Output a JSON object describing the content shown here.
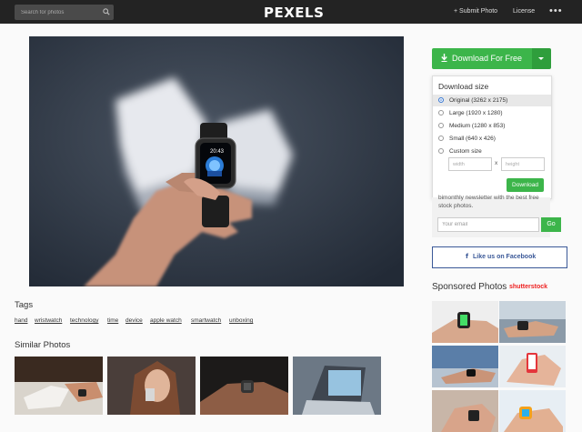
{
  "header": {
    "search_placeholder": "Search for photos",
    "logo": "PEXELS",
    "submit_label": "+ Submit Photo",
    "license_label": "License",
    "more_label": "•••"
  },
  "photo": {
    "watch_time": "20:43"
  },
  "download": {
    "button_label": "Download For Free",
    "dropdown_title": "Download size",
    "options": [
      {
        "label": "Original (3262 x 2175)",
        "selected": true
      },
      {
        "label": "Large (1920 x 1280)",
        "selected": false
      },
      {
        "label": "Medium (1280 x 853)",
        "selected": false
      },
      {
        "label": "Small (640 x 426)",
        "selected": false
      },
      {
        "label": "Custom size",
        "selected": false
      }
    ],
    "width_placeholder": "width",
    "height_placeholder": "height",
    "x_label": "x",
    "submit_label": "Download"
  },
  "newsletter": {
    "text": "bimonthly newsletter with the best free stock photos.",
    "email_placeholder": "Your email",
    "go_label": "Go"
  },
  "facebook": {
    "icon": "f",
    "label": "Like us on Facebook"
  },
  "sponsored": {
    "title": "Sponsored Photos",
    "provider": "shutterstock"
  },
  "tags": {
    "title": "Tags",
    "items": [
      "hand",
      "wristwatch",
      "technology",
      "time",
      "device",
      "apple watch",
      "smartwatch",
      "unboxing"
    ]
  },
  "similar": {
    "title": "Similar Photos"
  },
  "colors": {
    "accent_green": "#3cb54a",
    "topbar": "#232323",
    "facebook_blue": "#3b5998",
    "shutterstock_red": "#ee2222"
  }
}
